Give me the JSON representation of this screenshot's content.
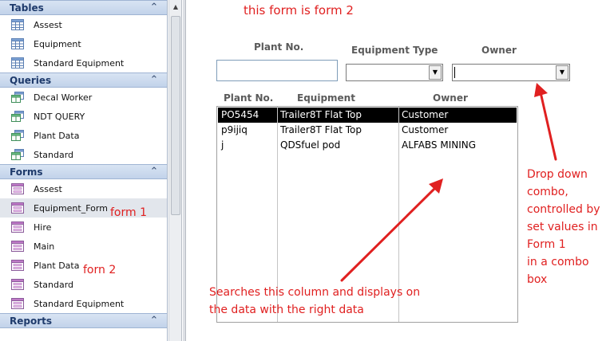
{
  "nav": {
    "groups": [
      {
        "title": "Tables",
        "items": [
          {
            "label": "Assest",
            "icon": "table-icon"
          },
          {
            "label": "Equipment",
            "icon": "table-icon"
          },
          {
            "label": "Standard Equipment",
            "icon": "table-icon"
          }
        ]
      },
      {
        "title": "Queries",
        "items": [
          {
            "label": "Decal Worker",
            "icon": "query-icon"
          },
          {
            "label": "NDT QUERY",
            "icon": "query-icon"
          },
          {
            "label": "Plant Data",
            "icon": "query-icon"
          },
          {
            "label": "Standard",
            "icon": "query-icon"
          }
        ]
      },
      {
        "title": "Forms",
        "items": [
          {
            "label": "Assest",
            "icon": "form-icon"
          },
          {
            "label": "Equipment_Form",
            "icon": "form-icon",
            "selected": true
          },
          {
            "label": "Hire",
            "icon": "form-icon"
          },
          {
            "label": "Main",
            "icon": "form-icon"
          },
          {
            "label": "Plant Data",
            "icon": "form-icon"
          },
          {
            "label": "Standard",
            "icon": "form-icon"
          },
          {
            "label": "Standard Equipment",
            "icon": "form-icon"
          }
        ]
      },
      {
        "title": "Reports",
        "items": []
      }
    ]
  },
  "form": {
    "labels": {
      "plant_no": "Plant No.",
      "equipment_type": "Equipment Type",
      "owner": "Owner"
    },
    "plant_no_value": "",
    "equipment_type_value": "",
    "owner_value": "",
    "list": {
      "headers": [
        "Plant  No.",
        "Equipment",
        "Owner"
      ],
      "rows": [
        {
          "plant": "PO5454",
          "equipment": "Trailer8T Flat Top",
          "owner": "Customer",
          "selected": true
        },
        {
          "plant": "p9ijiq",
          "equipment": "Trailer8T Flat Top",
          "owner": "Customer"
        },
        {
          "plant": "j",
          "equipment": "QDSfuel pod",
          "owner": "ALFABS MINING"
        }
      ]
    }
  },
  "annotations": {
    "title": "this form is form 2",
    "form1": "form 1",
    "form2": "forn 2",
    "dropdown_note": [
      "Drop down",
      "combo,",
      "controlled by",
      "set values in",
      "Form 1",
      "in a combo",
      "box"
    ],
    "search_note": [
      "Searches this column and displays on",
      "the data with the right data"
    ],
    "color": "#e02020"
  }
}
